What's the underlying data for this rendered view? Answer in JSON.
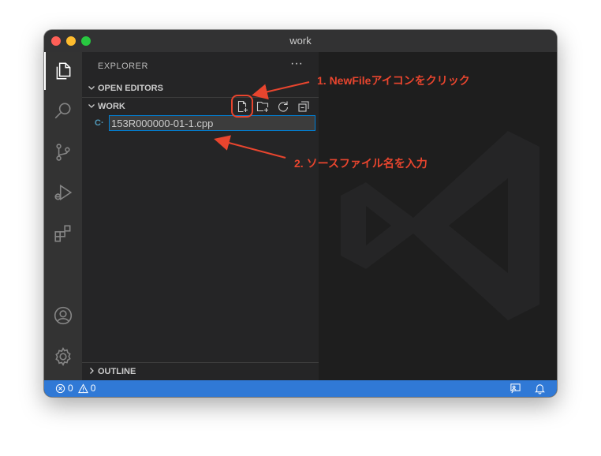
{
  "window": {
    "title": "work"
  },
  "activity_bar": {
    "items": [
      {
        "name": "explorer",
        "icon": "files-icon",
        "active": true
      },
      {
        "name": "search",
        "icon": "search-icon"
      },
      {
        "name": "source-control",
        "icon": "source-control-icon"
      },
      {
        "name": "run-and-debug",
        "icon": "run-debug-icon"
      },
      {
        "name": "extensions",
        "icon": "extensions-icon"
      }
    ],
    "bottom_items": [
      {
        "name": "accounts",
        "icon": "account-icon"
      },
      {
        "name": "manage",
        "icon": "gear-icon"
      }
    ]
  },
  "sidebar": {
    "title": "EXPLORER",
    "more": "···",
    "sections": {
      "open_editors": "OPEN EDITORS",
      "work": "WORK",
      "outline": "OUTLINE"
    },
    "work_actions": [
      "new-file-icon",
      "new-folder-icon",
      "refresh-icon",
      "collapse-all-icon"
    ],
    "file_icon": "C·",
    "new_file_input": "153R000000-01-1.cpp"
  },
  "statusbar": {
    "errors": "0",
    "warnings": "0"
  },
  "annotations": {
    "step1": "1. NewFileアイコンをクリック",
    "step2": "2. ソースファイル名を入力"
  },
  "colors": {
    "accent": "#3079d6",
    "annotation": "#e8452e",
    "input_border": "#007fd4"
  }
}
